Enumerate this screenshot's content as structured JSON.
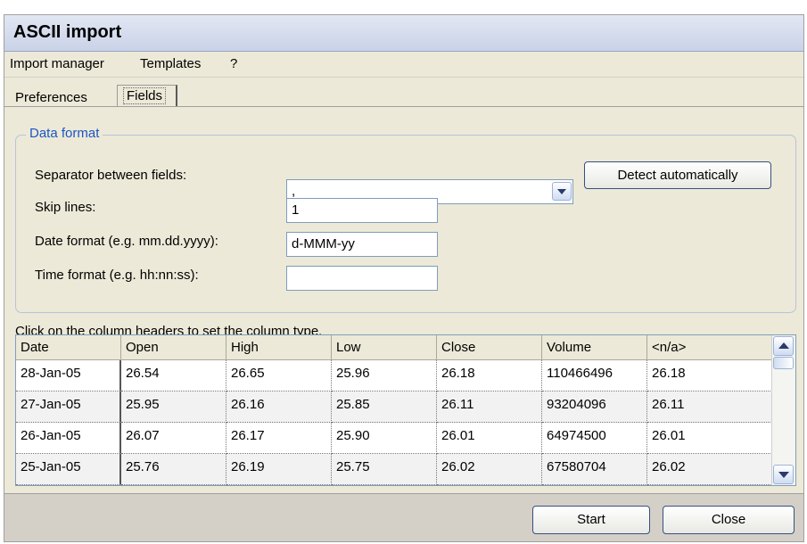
{
  "window": {
    "title": "ASCII import"
  },
  "menu": {
    "items": [
      "Import manager",
      "Templates",
      "?"
    ]
  },
  "tabs": [
    {
      "label": "Preferences"
    },
    {
      "label": "Fields",
      "active": true
    }
  ],
  "data_format": {
    "group_title": "Data format",
    "separator_label": "Separator between fields:",
    "separator_value": ",",
    "detect_button": "Detect automatically",
    "skip_label": "Skip lines:",
    "skip_value": "1",
    "date_label": "Date format (e.g. mm.dd.yyyy):",
    "date_value": "d-MMM-yy",
    "time_label": "Time format (e.g. hh:nn:ss):",
    "time_value": ""
  },
  "hint": "Click on the column headers to set the column type.",
  "table": {
    "headers": [
      "Date",
      "Open",
      "High",
      "Low",
      "Close",
      "Volume",
      "<n/a>"
    ],
    "rows": [
      [
        "28-Jan-05",
        "26.54",
        "26.65",
        "25.96",
        "26.18",
        "110466496",
        "26.18"
      ],
      [
        "27-Jan-05",
        "25.95",
        "26.16",
        "25.85",
        "26.11",
        "93204096",
        "26.11"
      ],
      [
        "26-Jan-05",
        "26.07",
        "26.17",
        "25.90",
        "26.01",
        "64974500",
        "26.01"
      ],
      [
        "25-Jan-05",
        "25.76",
        "26.19",
        "25.75",
        "26.02",
        "67580704",
        "26.02"
      ]
    ]
  },
  "footer": {
    "start_button": "Start",
    "close_button": "Close"
  },
  "colors": {
    "title_bar": "#c9d2e7",
    "group_title": "#1a56c6",
    "window_bg": "#ece9d8",
    "footer_bg": "#d4d0c8"
  },
  "icons": {
    "dropdown": "chevron-down-icon",
    "scroll_up": "scroll-up-icon",
    "scroll_down": "scroll-down-icon"
  }
}
